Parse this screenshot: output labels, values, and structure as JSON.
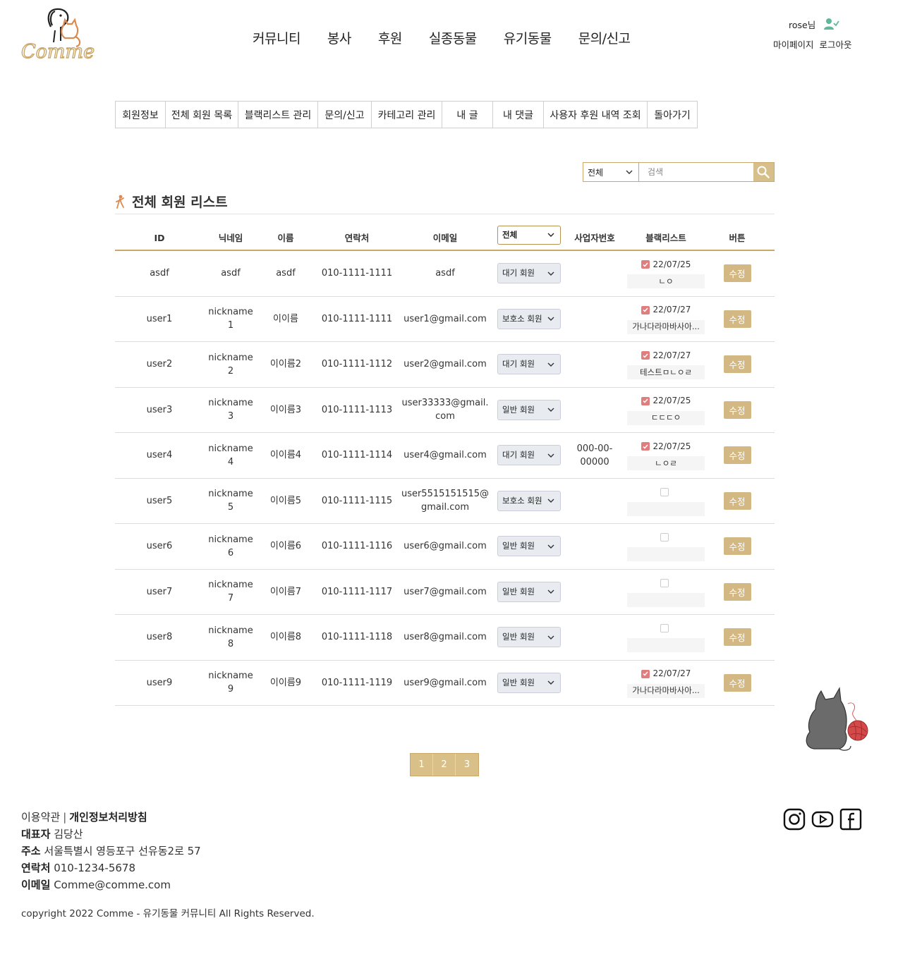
{
  "logo": {
    "text": "Comme",
    "icon": "dog-cat-logo-icon"
  },
  "nav": [
    "커뮤니티",
    "봉사",
    "후원",
    "실종동물",
    "유기동물",
    "문의/신고"
  ],
  "user": {
    "name": "rose님",
    "mypage": "마이페이지",
    "logout": "로그아웃",
    "icon": "user-check-icon"
  },
  "tabs": [
    "회원정보",
    "전체 회원 목록",
    "블랙리스트 관리",
    "문의/신고",
    "카테고리 관리",
    "내 글",
    "내 댓글",
    "사용자 후원 내역 조회",
    "돌아가기"
  ],
  "search": {
    "select": "전체",
    "placeholder": "검색",
    "icon": "search-icon"
  },
  "list_title": "전체 회원 리스트",
  "columns": {
    "id": "ID",
    "nickname": "닉네임",
    "name": "이름",
    "phone": "연락처",
    "email": "이메일",
    "type_filter": "전체",
    "biz": "사업자번호",
    "blacklist": "블랙리스트",
    "button": "버튼"
  },
  "rows": [
    {
      "id": "asdf",
      "nick1": "asdf",
      "nick2": "",
      "name": "asdf",
      "phone": "010-1111-1111",
      "email": "asdf",
      "type": "대기 회원",
      "biz": "",
      "bl_date": "22/07/25",
      "bl_memo": "ㄴㅇ",
      "bl_checked": "1",
      "edit": "수정"
    },
    {
      "id": "user1",
      "nick1": "nickname",
      "nick2": "1",
      "name": "이이름",
      "phone": "010-1111-1111",
      "email": "user1@gmail.com",
      "type": "보호소 회원",
      "biz": "",
      "bl_date": "22/07/27",
      "bl_memo": "가나다라마바사아...",
      "bl_checked": "1",
      "edit": "수정"
    },
    {
      "id": "user2",
      "nick1": "nickname",
      "nick2": "2",
      "name": "이이름2",
      "phone": "010-1111-1112",
      "email": "user2@gmail.com",
      "type": "대기 회원",
      "biz": "",
      "bl_date": "22/07/27",
      "bl_memo": "테스트ㅁㄴㅇㄹ",
      "bl_checked": "1",
      "edit": "수정"
    },
    {
      "id": "user3",
      "nick1": "nickname",
      "nick2": "3",
      "name": "이이름3",
      "phone": "010-1111-1113",
      "email": "user33333@gmail.com",
      "type": "일반 회원",
      "biz": "",
      "bl_date": "22/07/25",
      "bl_memo": "ㄷㄷㄷㅇ",
      "bl_checked": "1",
      "edit": "수정"
    },
    {
      "id": "user4",
      "nick1": "nickname",
      "nick2": "4",
      "name": "이이름4",
      "phone": "010-1111-1114",
      "email": "user4@gmail.com",
      "type": "대기 회원",
      "biz": "000-00-00000",
      "bl_date": "22/07/25",
      "bl_memo": "ㄴㅇㄹ",
      "bl_checked": "1",
      "edit": "수정"
    },
    {
      "id": "user5",
      "nick1": "nickname",
      "nick2": "5",
      "name": "이이름5",
      "phone": "010-1111-1115",
      "email": "user5515151515@gmail.com",
      "type": "보호소 회원",
      "biz": "",
      "bl_date": "",
      "bl_memo": "",
      "bl_checked": "0",
      "edit": "수정"
    },
    {
      "id": "user6",
      "nick1": "nickname",
      "nick2": "6",
      "name": "이이름6",
      "phone": "010-1111-1116",
      "email": "user6@gmail.com",
      "type": "일반 회원",
      "biz": "",
      "bl_date": "",
      "bl_memo": "",
      "bl_checked": "0",
      "edit": "수정"
    },
    {
      "id": "user7",
      "nick1": "nickname",
      "nick2": "7",
      "name": "이이름7",
      "phone": "010-1111-1117",
      "email": "user7@gmail.com",
      "type": "일반 회원",
      "biz": "",
      "bl_date": "",
      "bl_memo": "",
      "bl_checked": "0",
      "edit": "수정"
    },
    {
      "id": "user8",
      "nick1": "nickname",
      "nick2": "8",
      "name": "이이름8",
      "phone": "010-1111-1118",
      "email": "user8@gmail.com",
      "type": "일반 회원",
      "biz": "",
      "bl_date": "",
      "bl_memo": "",
      "bl_checked": "0",
      "edit": "수정"
    },
    {
      "id": "user9",
      "nick1": "nickname",
      "nick2": "9",
      "name": "이이름9",
      "phone": "010-1111-1119",
      "email": "user9@gmail.com",
      "type": "일반 회원",
      "biz": "",
      "bl_date": "22/07/27",
      "bl_memo": "가나다라마바사아...",
      "bl_checked": "1",
      "edit": "수정"
    }
  ],
  "pages": [
    "1",
    "2",
    "3"
  ],
  "footer": {
    "terms": "이용약관",
    "divider": "|",
    "privacy": "개인정보처리방침",
    "ceo_label": "대표자",
    "ceo": "김당산",
    "addr_label": "주소",
    "addr": "서울특별시 영등포구 선유동2로 57",
    "phone_label": "연락처",
    "phone": "010-1234-5678",
    "email_label": "이메일",
    "email": "Comme@comme.com",
    "copyright": "copyright 2022 Comme - 유기동물 커뮤니티 All Rights Reserved."
  },
  "social": [
    "instagram-icon",
    "youtube-icon",
    "facebook-icon"
  ],
  "decoration": "cat-with-yarn-icon",
  "colors": {
    "accent": "#d4b884",
    "accent_border": "#c9a86a",
    "check": "#e07e7e",
    "user_icon": "#5fb89a"
  }
}
